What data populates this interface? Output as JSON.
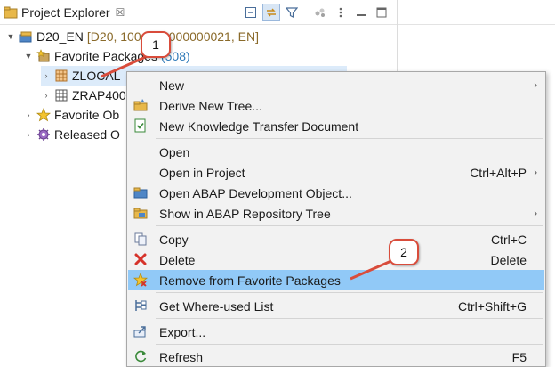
{
  "view": {
    "tab_title": "Project Explorer",
    "tab_close": "☒"
  },
  "tree": {
    "project": {
      "label": "D20_EN",
      "decoration": "[D20, 100, 000000000021, EN]"
    },
    "favorite_packages": {
      "label": "Favorite Packages",
      "count": "(508)"
    },
    "packages": [
      "ZLOCAL",
      "ZRAP400"
    ],
    "favorite_objects": {
      "label": "Favorite Ob"
    },
    "released_objects": {
      "label": "Released O"
    }
  },
  "context_menu": {
    "items": {
      "new": {
        "label": "New",
        "submenu": "›"
      },
      "derive_new_tree": {
        "label": "Derive New Tree..."
      },
      "new_ktd": {
        "label": "New Knowledge Transfer Document"
      },
      "open": {
        "label": "Open"
      },
      "open_in_project": {
        "label": "Open in Project",
        "accel": "Ctrl+Alt+P",
        "submenu": "›"
      },
      "open_abap_object": {
        "label": "Open ABAP Development Object..."
      },
      "show_in_repo_tree": {
        "label": "Show in ABAP Repository Tree",
        "submenu": "›"
      },
      "copy": {
        "label": "Copy",
        "accel": "Ctrl+C"
      },
      "delete": {
        "label": "Delete",
        "accel": "Delete"
      },
      "remove_favorite": {
        "label": "Remove from Favorite Packages"
      },
      "where_used": {
        "label": "Get Where-used List",
        "accel": "Ctrl+Shift+G"
      },
      "export": {
        "label": "Export..."
      },
      "refresh": {
        "label": "Refresh",
        "accel": "F5"
      }
    },
    "highlighted": "remove_favorite"
  },
  "annotations": {
    "step1": "1",
    "step2": "2",
    "color": "#d94c3b"
  },
  "colors": {
    "menu_highlight": "#91c9f7",
    "selection": "#dcebfa",
    "count_text": "#2f7ab8",
    "decoration_text": "#8a6a2a"
  }
}
